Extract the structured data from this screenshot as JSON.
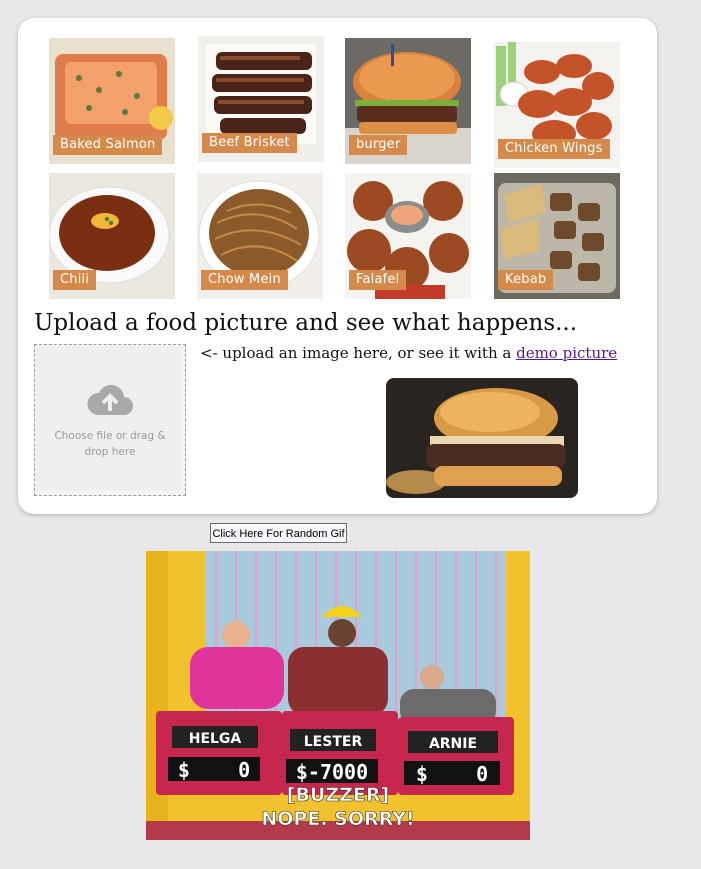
{
  "foods": [
    {
      "name": "Baked Salmon"
    },
    {
      "name": "Beef Brisket"
    },
    {
      "name": "burger"
    },
    {
      "name": "Chicken Wings"
    },
    {
      "name": "Chili"
    },
    {
      "name": "Chow Mein"
    },
    {
      "name": "Falafel"
    },
    {
      "name": "Kebab"
    }
  ],
  "heading": "Upload a food picture and see what happens...",
  "upload": {
    "text": "Choose file or drag & drop here",
    "icon": "cloud-upload-icon"
  },
  "hint": {
    "prefix": "<- upload an image here, or see it with a ",
    "link": "demo picture"
  },
  "gif_button": "Click Here For Random Gif",
  "gif": {
    "contestants": [
      "HELGA",
      "LESTER",
      "ARNIE"
    ],
    "scores": [
      "$    0",
      "$-7000",
      "$    0"
    ],
    "caption_line1": "[BUZZER]",
    "caption_line2": "NOPE. SORRY!"
  }
}
